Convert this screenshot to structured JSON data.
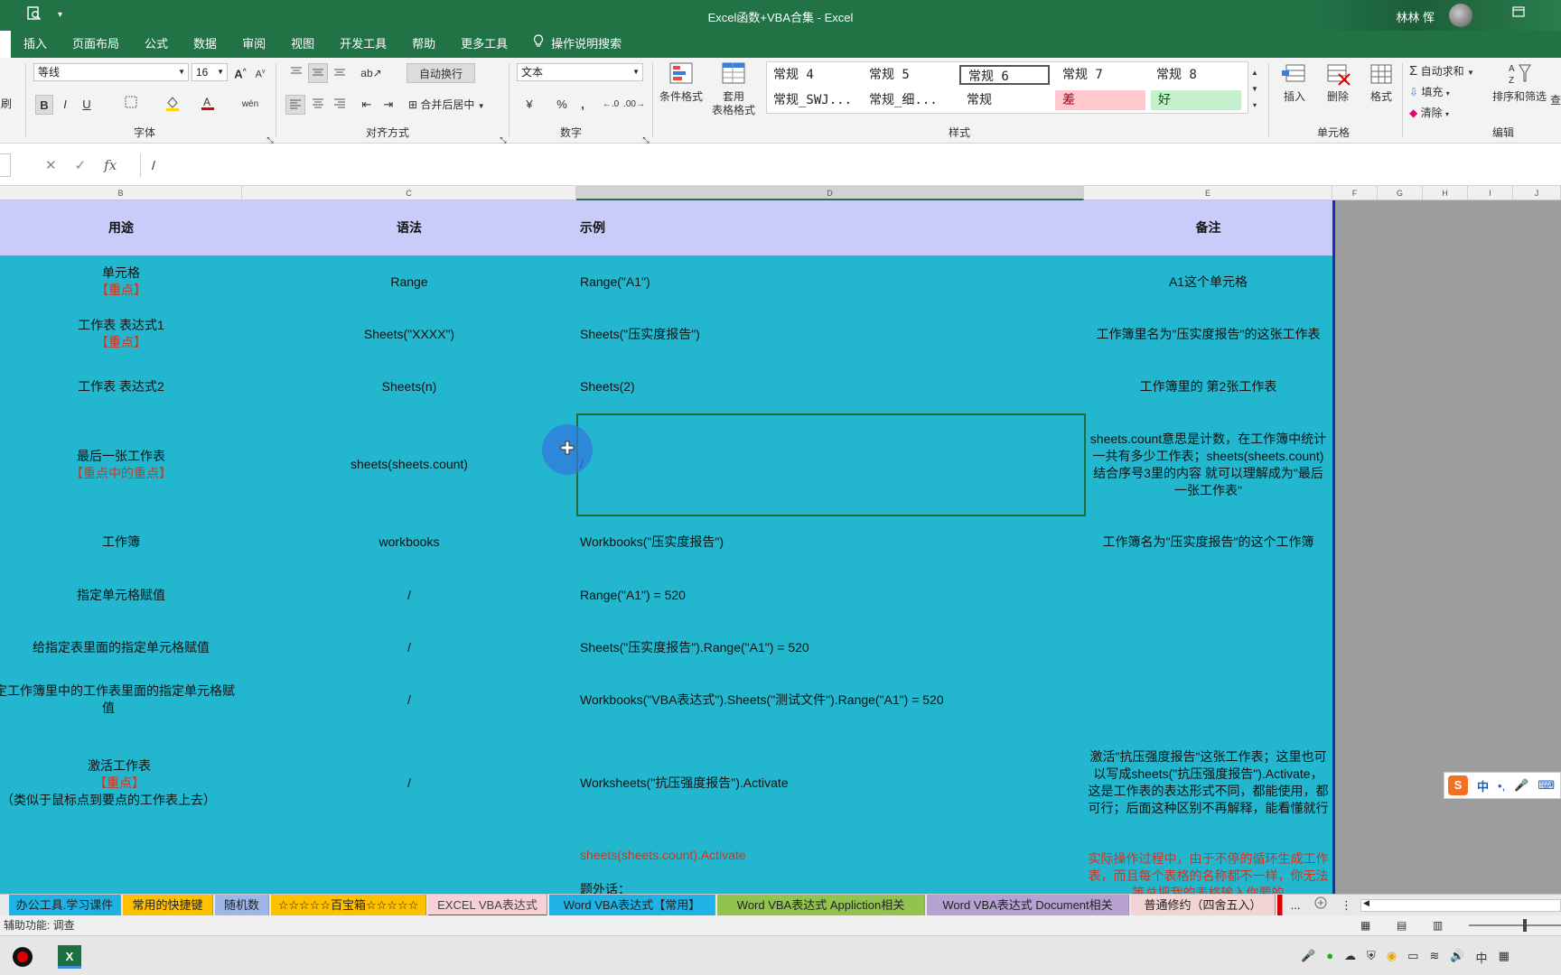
{
  "titlebar": {
    "title": "Excel函数+VBA合集  -  Excel",
    "user": "林林 恽",
    "win_icon": "restore-icon"
  },
  "tabs": [
    "插入",
    "页面布局",
    "公式",
    "数据",
    "审阅",
    "视图",
    "开发工具",
    "帮助",
    "更多工具"
  ],
  "tell_me": "操作说明搜索",
  "ribbon": {
    "font_name": "等线",
    "font_size": "16",
    "wrap_text": "自动换行",
    "merge_center": "合并后居中",
    "number_format": "文本",
    "cond_format": "条件格式",
    "table_format_1": "套用",
    "table_format_2": "表格格式",
    "styles": [
      "常规 4",
      "常规 5",
      "常规 6",
      "常规 7",
      "常规 8",
      "常规_SWJ...",
      "常规_细...",
      "常规",
      "差",
      "好"
    ],
    "insert": "插入",
    "delete": "删除",
    "format": "格式",
    "autosum": "自动求和",
    "fill": "填充",
    "clear": "清除",
    "sort_filter": "排序和筛选",
    "find": "查",
    "left_partial": "刷",
    "groups": {
      "font": "字体",
      "align": "对齐方式",
      "number": "数字",
      "styles": "样式",
      "cells": "单元格",
      "edit": "编辑"
    }
  },
  "formula": {
    "value": "/"
  },
  "columns": [
    "B",
    "C",
    "D",
    "E",
    "F",
    "G",
    "H",
    "I",
    "J"
  ],
  "table": {
    "headers": [
      "用途",
      "语法",
      "示例",
      "备注"
    ],
    "rows": [
      {
        "b1": "单元格",
        "b2": "【重点】",
        "b3": "",
        "c": "Range",
        "d": "Range(\"A1\")",
        "e": "A1这个单元格"
      },
      {
        "b1": "工作表 表达式1",
        "b2": "【重点】",
        "b3": "",
        "c": "Sheets(\"XXXX\")",
        "d": "Sheets(\"压实度报告\")",
        "e": "工作簿里名为\"压实度报告\"的这张工作表"
      },
      {
        "b1": "工作表 表达式2",
        "b2": "",
        "b3": "",
        "c": "Sheets(n)",
        "d": "Sheets(2)",
        "e": "工作簿里的 第2张工作表"
      },
      {
        "b1": "最后一张工作表",
        "b2": "【重点中的重点】",
        "b3": "",
        "c": "sheets(sheets.count)",
        "d": "/",
        "e": "sheets.count意思是计数，在工作簿中统计一共有多少工作表；sheets(sheets.count) 结合序号3里的内容 就可以理解成为\"最后一张工作表\""
      },
      {
        "b1": "工作簿",
        "b2": "",
        "b3": "",
        "c": "workbooks",
        "d": "Workbooks(\"压实度报告\")",
        "e": "工作簿名为\"压实度报告\"的这个工作簿"
      },
      {
        "b1": "指定单元格赋值",
        "b2": "",
        "b3": "",
        "c": "/",
        "d": "Range(\"A1\") = 520",
        "e": ""
      },
      {
        "b1": "给指定表里面的指定单元格赋值",
        "b2": "",
        "b3": "",
        "c": "/",
        "d": "Sheets(\"压实度报告\").Range(\"A1\") = 520",
        "e": ""
      },
      {
        "b1": "指定工作簿里中的工作表里面的指定单元格赋值",
        "b2": "",
        "b3": "",
        "c": "/",
        "d": "Workbooks(\"VBA表达式\").Sheets(\"测试文件\").Range(\"A1\") = 520",
        "e": ""
      },
      {
        "b1": "激活工作表",
        "b2": "【重点】",
        "b3": "（类似于鼠标点到要点的工作表上去）",
        "c": "/",
        "d": "Worksheets(\"抗压强度报告\").Activate",
        "e": "激活\"抗压强度报告\"这张工作表；这里也可以写成sheets(\"抗压强度报告\").Activate，这是工作表的表达形式不同，都能使用，都可行；后面这种区别不再解释，能看懂就行"
      },
      {
        "b1": "",
        "b2": "",
        "b3": "",
        "c": "",
        "d": "sheets(sheets.count).Activate",
        "d2": "题外话：",
        "e": "实际操作过程中，由于不停的循环生成工作表，而且每个表格的名称都不一样，你无法等总把我的表格输入你要的"
      }
    ]
  },
  "sheets": [
    "办公工具.学习课件",
    "常用的快捷键",
    "随机数",
    "☆☆☆☆☆百宝箱☆☆☆☆☆",
    "EXCEL VBA表达式",
    "Word VBA表达式【常用】",
    "Word VBA表达式 Appliction相关",
    "Word VBA表达式 Document相关",
    "普通修约（四舍五入）",
    "..."
  ],
  "status": "辅助功能: 调查",
  "ime": {
    "lang": "中",
    "punct": "•,",
    "logo": "S"
  },
  "colors": {
    "excel_green": "#217346",
    "header_fill": "#c9ccf8",
    "body_fill": "#22b7cf",
    "note_red": "#d6331b"
  }
}
